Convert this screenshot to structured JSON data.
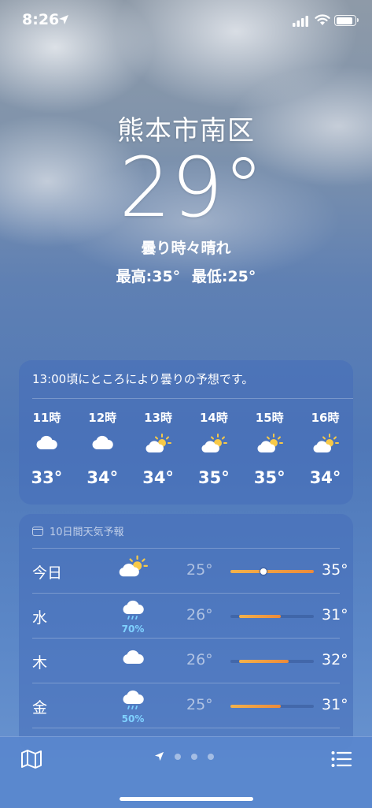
{
  "status_bar": {
    "time": "8:26"
  },
  "location": {
    "city": "熊本市南区",
    "temperature": "29°",
    "condition": "曇り時々晴れ",
    "high": "最高:35°",
    "low": "最低:25°"
  },
  "hourly": {
    "summary": "13:00頃にところにより曇りの予想です。",
    "hours": [
      {
        "label": "11時",
        "icon": "cloud-icon",
        "temp": "33°"
      },
      {
        "label": "12時",
        "icon": "cloud-icon",
        "temp": "34°"
      },
      {
        "label": "13時",
        "icon": "partly-sunny-icon",
        "temp": "34°"
      },
      {
        "label": "14時",
        "icon": "partly-sunny-icon",
        "temp": "35°"
      },
      {
        "label": "15時",
        "icon": "partly-sunny-icon",
        "temp": "35°"
      },
      {
        "label": "16時",
        "icon": "partly-sunny-icon",
        "temp": "34°"
      }
    ]
  },
  "daily": {
    "header": "10日間天気予報",
    "range_min": 25,
    "range_max": 35,
    "current_temp": 29,
    "days": [
      {
        "day": "今日",
        "icon": "partly-sunny-icon",
        "pop": "",
        "low": "25°",
        "high": "35°",
        "low_val": 25,
        "high_val": 35
      },
      {
        "day": "水",
        "icon": "rain-cloud-icon",
        "pop": "70%",
        "low": "26°",
        "high": "31°",
        "low_val": 26,
        "high_val": 31
      },
      {
        "day": "木",
        "icon": "cloud-icon",
        "pop": "",
        "low": "26°",
        "high": "32°",
        "low_val": 26,
        "high_val": 32
      },
      {
        "day": "金",
        "icon": "rain-cloud-icon",
        "pop": "50%",
        "low": "25°",
        "high": "31°",
        "low_val": 25,
        "high_val": 31
      }
    ]
  },
  "colors": {
    "precip_text": "#7fd1ff",
    "bar_start": "#f3b24b",
    "bar_end": "#ec8a3a",
    "sun": "#f7c948"
  }
}
